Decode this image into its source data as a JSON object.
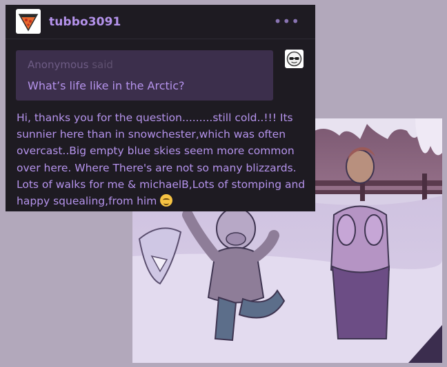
{
  "post": {
    "username": "tubbo3091",
    "more_label": "•••",
    "ask": {
      "asker": "Anonymous",
      "said": "said",
      "question": "What’s life like in the Arctic?"
    },
    "answer": "Hi, thanks you for the question.........still cold..!!! Its sunnier here than in snowchester,which was often overcast..Big empty blue skies seem more common over here. Where There's are not so many blizzards. Lots of walks for me & michaelB,Lots of stomping and happy squealing,from him",
    "emoji": "smiling-face-with-blushing-eyes"
  },
  "colors": {
    "background": "#b2a8bb",
    "card": "#1e1b22",
    "ask_bubble": "#3c2f4c",
    "accent_text": "#b593ec",
    "muted_text": "#6e5c85"
  },
  "icons": {
    "avatar": "pizza-slice-avatar-icon",
    "ask_avatar": "sunglasses-avatar-icon",
    "more": "ellipsis-icon"
  }
}
